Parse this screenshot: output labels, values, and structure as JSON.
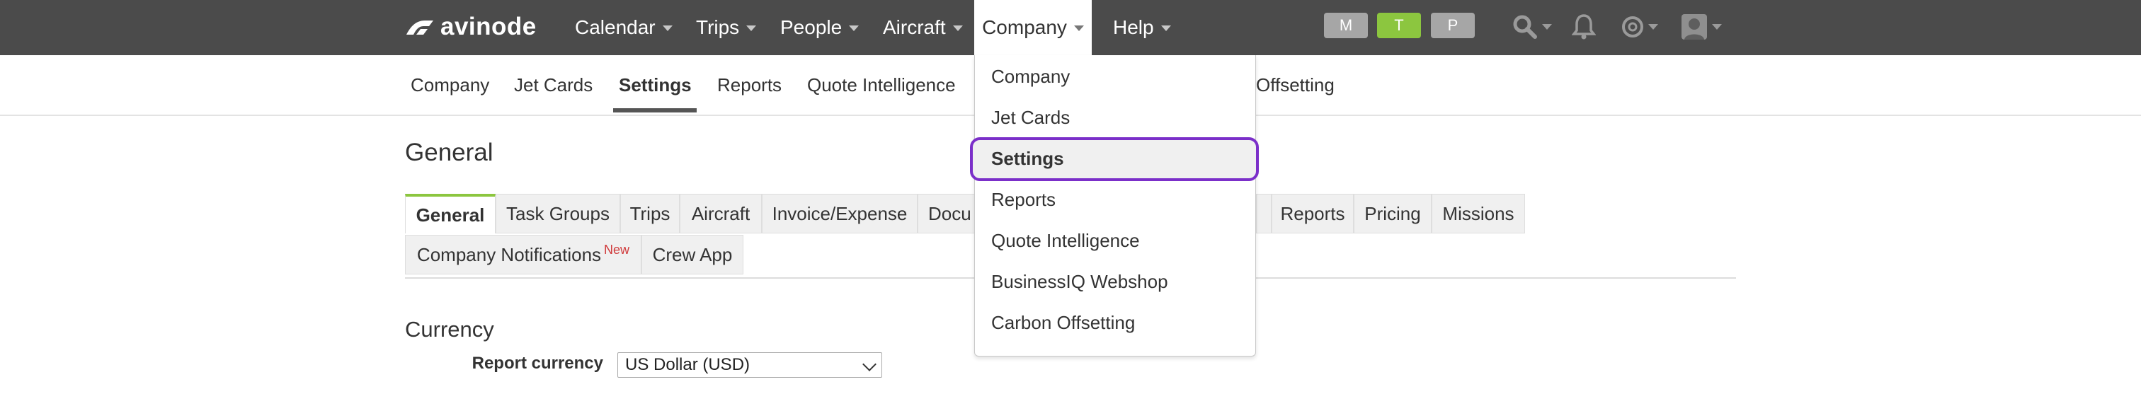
{
  "brand": {
    "name": "avinode"
  },
  "topnav": {
    "items": [
      {
        "label": "Calendar"
      },
      {
        "label": "Trips"
      },
      {
        "label": "People"
      },
      {
        "label": "Aircraft"
      },
      {
        "label": "Company"
      },
      {
        "label": "Help"
      }
    ],
    "env_buttons": [
      {
        "label": "M",
        "color": "#a6a6a6"
      },
      {
        "label": "T",
        "color": "#8cc63f"
      },
      {
        "label": "P",
        "color": "#a6a6a6"
      }
    ],
    "icons": [
      "search-icon",
      "bell-icon",
      "help-lifebuoy-icon",
      "user-avatar-icon"
    ]
  },
  "subnav": {
    "items": [
      {
        "label": "Company"
      },
      {
        "label": "Jet Cards"
      },
      {
        "label": "Settings"
      },
      {
        "label": "Reports"
      },
      {
        "label": "Quote Intelligence"
      },
      {
        "label": "Offsetting"
      }
    ]
  },
  "page": {
    "title": "General",
    "tabs_row1": [
      {
        "label": "General"
      },
      {
        "label": "Task Groups"
      },
      {
        "label": "Trips"
      },
      {
        "label": "Aircraft"
      },
      {
        "label": "Invoice/Expense"
      },
      {
        "label": "Docu"
      },
      {
        "label": "Reports"
      },
      {
        "label": "Pricing"
      },
      {
        "label": "Missions"
      }
    ],
    "tabs_row2": [
      {
        "label": "Company Notifications",
        "badge": "New"
      },
      {
        "label": "Crew App"
      }
    ],
    "section_title": "Currency",
    "report_currency": {
      "label": "Report currency",
      "value": "US Dollar (USD)"
    }
  },
  "dropdown": {
    "items": [
      {
        "label": "Company"
      },
      {
        "label": "Jet Cards"
      },
      {
        "label": "Settings"
      },
      {
        "label": "Reports"
      },
      {
        "label": "Quote Intelligence"
      },
      {
        "label": "BusinessIQ Webshop"
      },
      {
        "label": "Carbon Offsetting"
      }
    ]
  },
  "colors": {
    "topbar": "#4b4b4b",
    "accent_green": "#8cc63f",
    "highlight_purple": "#7b2fc9",
    "new_badge": "#d0393a"
  }
}
